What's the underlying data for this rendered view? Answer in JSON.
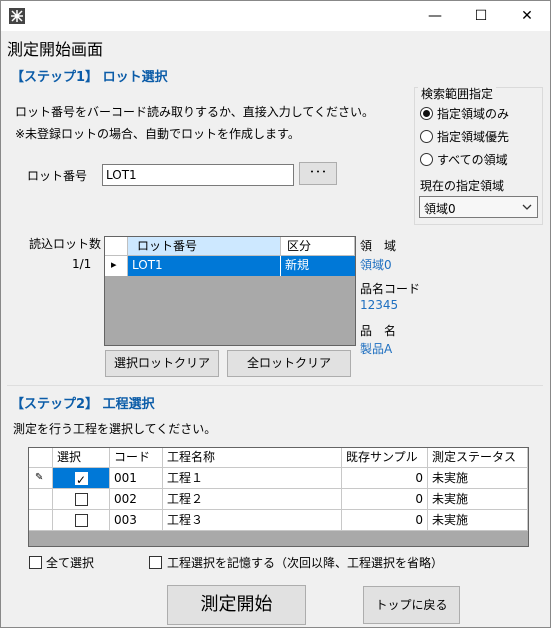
{
  "window": {
    "minimize_glyph": "—",
    "maximize_glyph": "☐",
    "close_glyph": "✕"
  },
  "screen_title": "測定開始画面",
  "step1": {
    "title": "【ステップ1】 ロット選択",
    "instruction1": "ロット番号をバーコード読み取りするか、直接入力してください。",
    "instruction2": "※未登録ロットの場合、自動でロットを作成します。",
    "lot_label": "ロット番号",
    "lot_value": "LOT1",
    "browse_label": "･･･",
    "read_count_label": "読込ロット数",
    "read_count_value": "1/1",
    "grid": {
      "columns": [
        "ロット番号",
        "区分"
      ],
      "rows": [
        {
          "lot": "LOT1",
          "kind": "新規"
        }
      ],
      "row_marker": "▸"
    },
    "area_label": "領　域",
    "area_value": "領域0",
    "product_code_label": "品名コード",
    "product_code_value": "12345",
    "product_name_label": "品　名",
    "product_name_value": "製品A",
    "clear_selected_label": "選択ロットクリア",
    "clear_all_label": "全ロットクリア"
  },
  "search_range": {
    "title": "検索範囲指定",
    "options": [
      "指定領域のみ",
      "指定領域優先",
      "すべての領域"
    ],
    "selected_index": 0,
    "current_area_label": "現在の指定領域",
    "current_area_value": "領域0"
  },
  "step2": {
    "title": "【ステップ2】 工程選択",
    "instruction": "測定を行う工程を選択してください。",
    "columns": [
      "選択",
      "コード",
      "工程名称",
      "既存サンプル",
      "測定ステータス"
    ],
    "edit_marker": "✎",
    "rows": [
      {
        "selected": true,
        "code": "001",
        "name": "工程１",
        "existing": "0",
        "status": "未実施"
      },
      {
        "selected": false,
        "code": "002",
        "name": "工程２",
        "existing": "0",
        "status": "未実施"
      },
      {
        "selected": false,
        "code": "003",
        "name": "工程３",
        "existing": "0",
        "status": "未実施"
      }
    ],
    "select_all_label": "全て選択",
    "remember_label": "工程選択を記憶する（次回以降、工程選択を省略）"
  },
  "start_button_label": "測定開始",
  "back_button_label": "トップに戻る",
  "colors": {
    "accent": "#0b5ca8",
    "selection": "#0078d7",
    "link": "#1e6fc0"
  }
}
